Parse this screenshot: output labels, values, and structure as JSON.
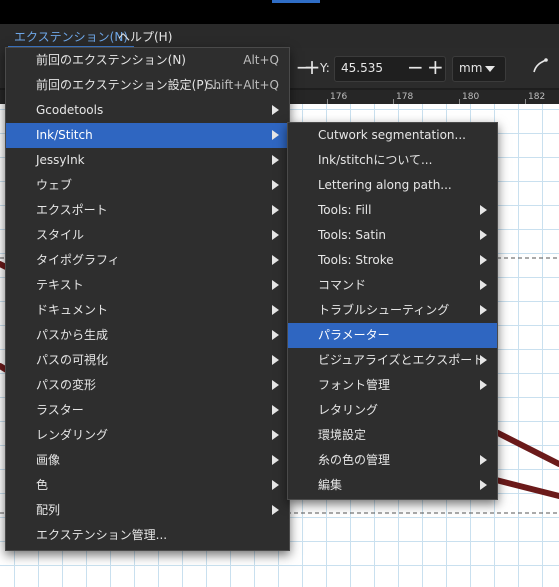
{
  "menubar": {
    "extensions": "エクステンション(N)",
    "help": "ヘルプ(H)"
  },
  "toolbar": {
    "y_label": "Y:",
    "y_value": "45.535",
    "unit": "mm",
    "minus": "−",
    "plus": "+"
  },
  "ruler": {
    "ticks": [
      "176",
      "178",
      "180",
      "182"
    ]
  },
  "extensions_menu": {
    "items": [
      {
        "label": "前回のエクステンション(N)",
        "shortcut": "Alt+Q"
      },
      {
        "label": "前回のエクステンション設定(P)...",
        "shortcut": "Shift+Alt+Q"
      },
      {
        "label": "Gcodetools"
      },
      {
        "label": "Ink/Stitch"
      },
      {
        "label": "JessyInk"
      },
      {
        "label": "ウェブ"
      },
      {
        "label": "エクスポート"
      },
      {
        "label": "スタイル"
      },
      {
        "label": "タイポグラフィ"
      },
      {
        "label": "テキスト"
      },
      {
        "label": "ドキュメント"
      },
      {
        "label": "パスから生成"
      },
      {
        "label": "パスの可視化"
      },
      {
        "label": "パスの変形"
      },
      {
        "label": "ラスター"
      },
      {
        "label": "レンダリング"
      },
      {
        "label": "画像"
      },
      {
        "label": "色"
      },
      {
        "label": "配列"
      },
      {
        "label": "エクステンション管理..."
      }
    ]
  },
  "inkstitch_submenu": {
    "items": [
      {
        "label": "Cutwork segmentation..."
      },
      {
        "label": "Ink/stitchについて..."
      },
      {
        "label": "Lettering along path..."
      },
      {
        "label": "Tools: Fill"
      },
      {
        "label": "Tools: Satin"
      },
      {
        "label": "Tools: Stroke"
      },
      {
        "label": "コマンド"
      },
      {
        "label": "トラブルシューティング"
      },
      {
        "label": "パラメーター"
      },
      {
        "label": "ビジュアライズとエクスポート"
      },
      {
        "label": "フォント管理"
      },
      {
        "label": "レタリング"
      },
      {
        "label": "環境設定"
      },
      {
        "label": "糸の色の管理"
      },
      {
        "label": "編集"
      }
    ]
  },
  "colors": {
    "highlight": "#2f66c1",
    "menu_bg": "#2e2e2e",
    "path": "#6b1a1a"
  }
}
